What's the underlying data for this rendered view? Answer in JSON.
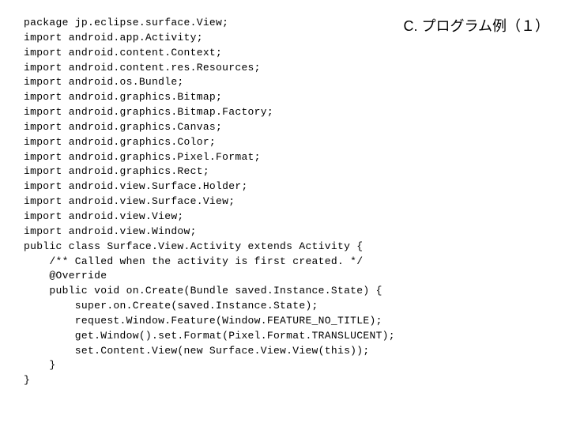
{
  "heading": "C. プログラム例（１）",
  "code_lines": [
    "package jp.eclipse.surface.View;",
    "import android.app.Activity;",
    "import android.content.Context;",
    "import android.content.res.Resources;",
    "import android.os.Bundle;",
    "import android.graphics.Bitmap;",
    "import android.graphics.Bitmap.Factory;",
    "import android.graphics.Canvas;",
    "import android.graphics.Color;",
    "import android.graphics.Pixel.Format;",
    "import android.graphics.Rect;",
    "import android.view.Surface.Holder;",
    "import android.view.Surface.View;",
    "import android.view.View;",
    "import android.view.Window;",
    "public class Surface.View.Activity extends Activity {",
    "    /** Called when the activity is first created. */",
    "    @Override",
    "    public void on.Create(Bundle saved.Instance.State) {",
    "        super.on.Create(saved.Instance.State);",
    "        request.Window.Feature(Window.FEATURE_NO_TITLE);",
    "        get.Window().set.Format(Pixel.Format.TRANSLUCENT);",
    "        set.Content.View(new Surface.View.View(this));",
    "    }",
    "}"
  ]
}
